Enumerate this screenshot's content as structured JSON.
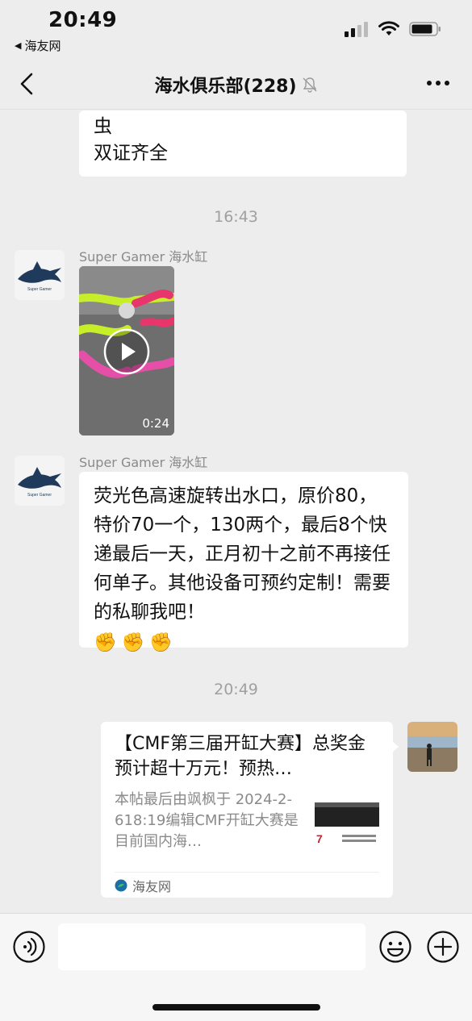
{
  "status_bar": {
    "time": "20:49",
    "back_app": "海友网"
  },
  "nav": {
    "title": "海水俱乐部(228)"
  },
  "messages": {
    "previous_line1": "虫",
    "previous_line2": "双证齐全",
    "timestamp1": "16:43",
    "video": {
      "sender": "Super Gamer 海水缸",
      "duration": "0:24"
    },
    "text": {
      "sender": "Super Gamer 海水缸",
      "body": "荧光色高速旋转出水口，原价80，特价70一个，130两个，最后8个快递最后一天，正月初十之前不再接任何单子。其他设备可预约定制！需要的私聊我吧！",
      "emojis": [
        "✊",
        "✊",
        "✊"
      ]
    },
    "timestamp2": "20:49",
    "link": {
      "title": "【CMF第三届开缸大赛】总奖金预计超十万元！预热…",
      "description": "本帖最后由飒枫于 2024-2-618:19编辑CMF开缸大赛是目前国内海…",
      "source": "海友网"
    }
  },
  "colors": {
    "background": "#ededed",
    "bubble": "#ffffff",
    "muted_text": "#8a8a8a"
  },
  "icons": [
    "back-arrow-icon",
    "mute-bell-icon",
    "more-dots-icon",
    "voice-icon",
    "emoji-icon",
    "plus-icon",
    "play-icon",
    "wifi-icon",
    "signal-icon",
    "battery-icon"
  ]
}
